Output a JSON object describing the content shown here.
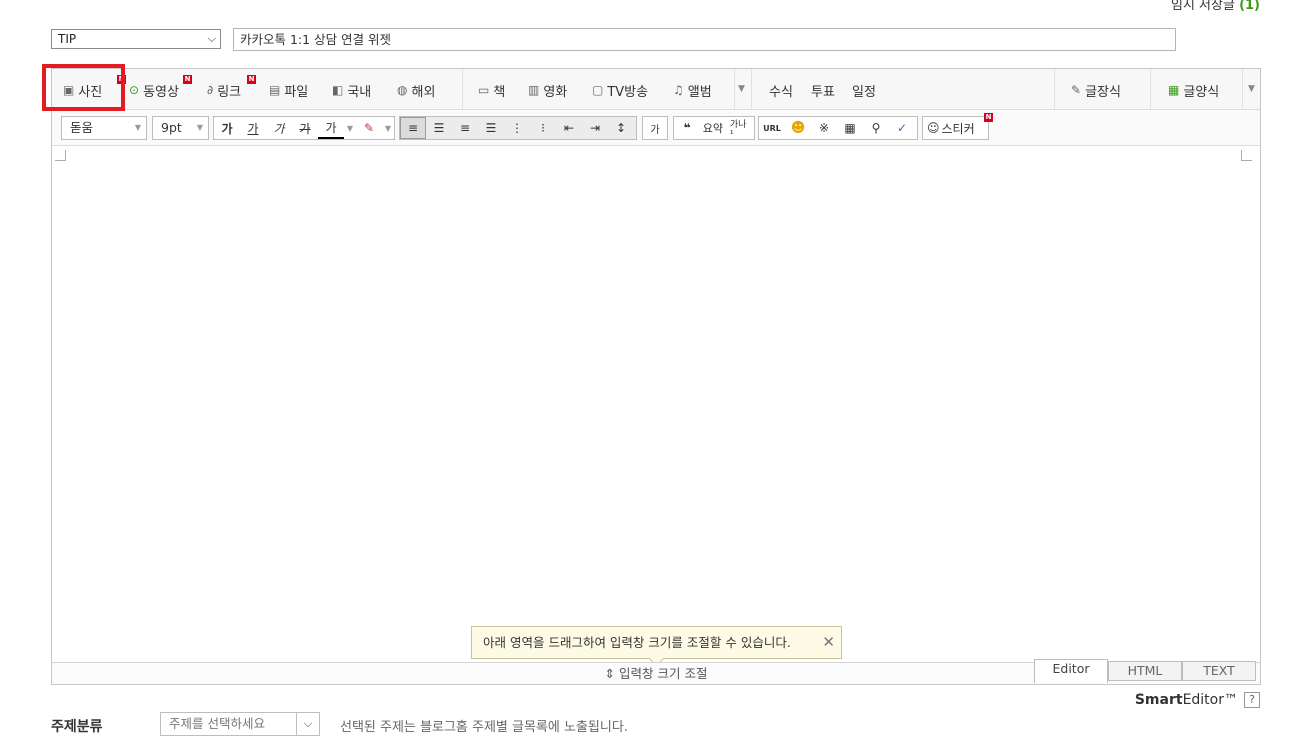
{
  "temp_save": {
    "label": "임시 저장글",
    "count": "(1)"
  },
  "category": {
    "selected": "TIP"
  },
  "title": {
    "value": "카카오톡 1:1 상담 연결 위젯"
  },
  "toolbar1": {
    "photo": "사진",
    "video": "동영상",
    "link": "링크",
    "file": "파일",
    "domestic": "국내",
    "overseas": "해외",
    "book": "책",
    "movie": "영화",
    "tv": "TV방송",
    "album": "앨범",
    "formula": "수식",
    "vote": "투표",
    "schedule": "일정",
    "quote_style": "글장식",
    "template": "글양식",
    "new_badge": "N"
  },
  "toolbar2": {
    "font": "돋움",
    "size": "9pt",
    "bold": "가",
    "underline": "가",
    "italic": "가",
    "strike": "가",
    "fontcolor": "가",
    "spellcheck": "가",
    "quote": "❝",
    "summary": "요약",
    "sup": "가나¹",
    "url": "URL",
    "sticker": "스티커"
  },
  "resize_tip": {
    "text": "아래 영역을 드래그하여 입력창 크기를 조절할 수 있습니다.",
    "close": "✕"
  },
  "resize_bar": {
    "label": "⇕ 입력창 크기 조절"
  },
  "mode_tabs": {
    "editor": "Editor",
    "html": "HTML",
    "text": "TEXT"
  },
  "brand": {
    "smart": "Smart",
    "editor": "Editor™",
    "help": "?"
  },
  "topic": {
    "label": "주제분류",
    "placeholder": "주제를 선택하세요",
    "desc": "선택된 주제는 블로그홈 주제별 글목록에 노출됩니다."
  }
}
